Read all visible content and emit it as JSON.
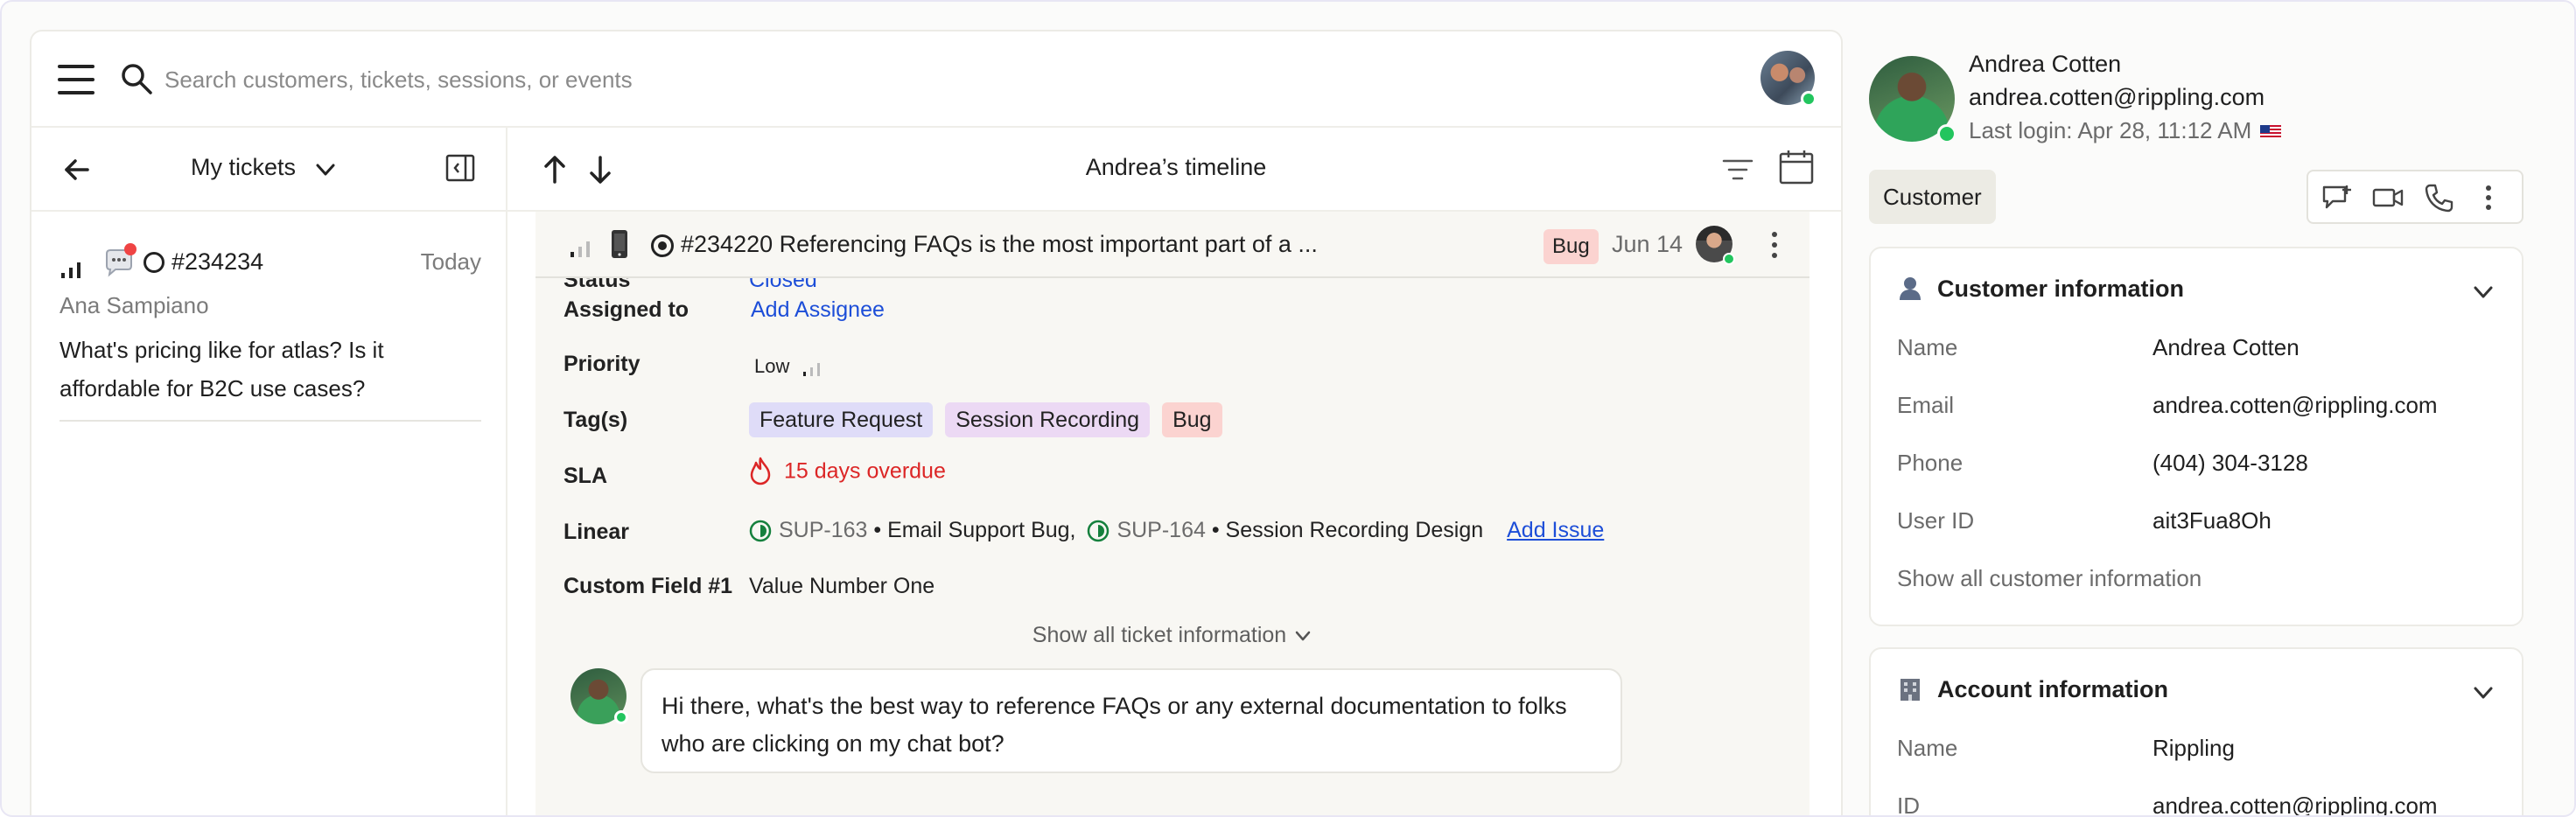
{
  "search": {
    "placeholder": "Search customers, tickets, sessions, or events"
  },
  "ticket_list": {
    "title": "My tickets",
    "items": [
      {
        "number": "#234234",
        "date": "Today",
        "author": "Ana Sampiano",
        "body": "What's pricing like for atlas? Is it affordable for B2C use cases?"
      }
    ]
  },
  "timeline": {
    "title": "Andrea’s timeline",
    "ticket": {
      "title": "#234220 Referencing FAQs is the most important part of a ...",
      "badge": "Bug",
      "date": "Jun 14"
    },
    "fields": {
      "status_label": "Status",
      "status_value": "Closed",
      "assigned_label": "Assigned to",
      "assigned_value": "Add Assignee",
      "priority_label": "Priority",
      "priority_value": "Low",
      "tags_label": "Tag(s)",
      "tags": [
        "Feature Request",
        "Session Recording",
        "Bug"
      ],
      "sla_label": "SLA",
      "sla_value": "15 days overdue",
      "linear_label": "Linear",
      "linear_1_code": "SUP-163",
      "linear_1_text": "• Email Support Bug,",
      "linear_2_code": "SUP-164",
      "linear_2_text": "• Session Recording Design",
      "add_issue": "Add Issue",
      "custom_label": "Custom Field #1",
      "custom_value": "Value Number One"
    },
    "show_all": "Show all ticket information",
    "message": "Hi there, what's the best way to reference FAQs or any external documentation to folks who are clicking on my chat bot?"
  },
  "customer": {
    "name": "Andrea Cotten",
    "email": "andrea.cotten@rippling.com",
    "last_login": "Last login: Apr 28, 11:12 AM",
    "badge": "Customer"
  },
  "customer_info": {
    "title": "Customer information",
    "rows": [
      {
        "label": "Name",
        "value": "Andrea Cotten"
      },
      {
        "label": "Email",
        "value": "andrea.cotten@rippling.com"
      },
      {
        "label": "Phone",
        "value": "(404) 304-3128"
      },
      {
        "label": "User ID",
        "value": "ait3Fua8Oh"
      }
    ],
    "show_all": "Show all customer information"
  },
  "account_info": {
    "title": "Account information",
    "rows": [
      {
        "label": "Name",
        "value": "Rippling"
      },
      {
        "label": "ID",
        "value": "andrea.cotten@rippling.com"
      }
    ]
  },
  "colors": {
    "accent_link": "#1d4ed8",
    "online": "#22c55e",
    "overdue": "#dc2626",
    "bug_badge": "#fbd3d0"
  }
}
